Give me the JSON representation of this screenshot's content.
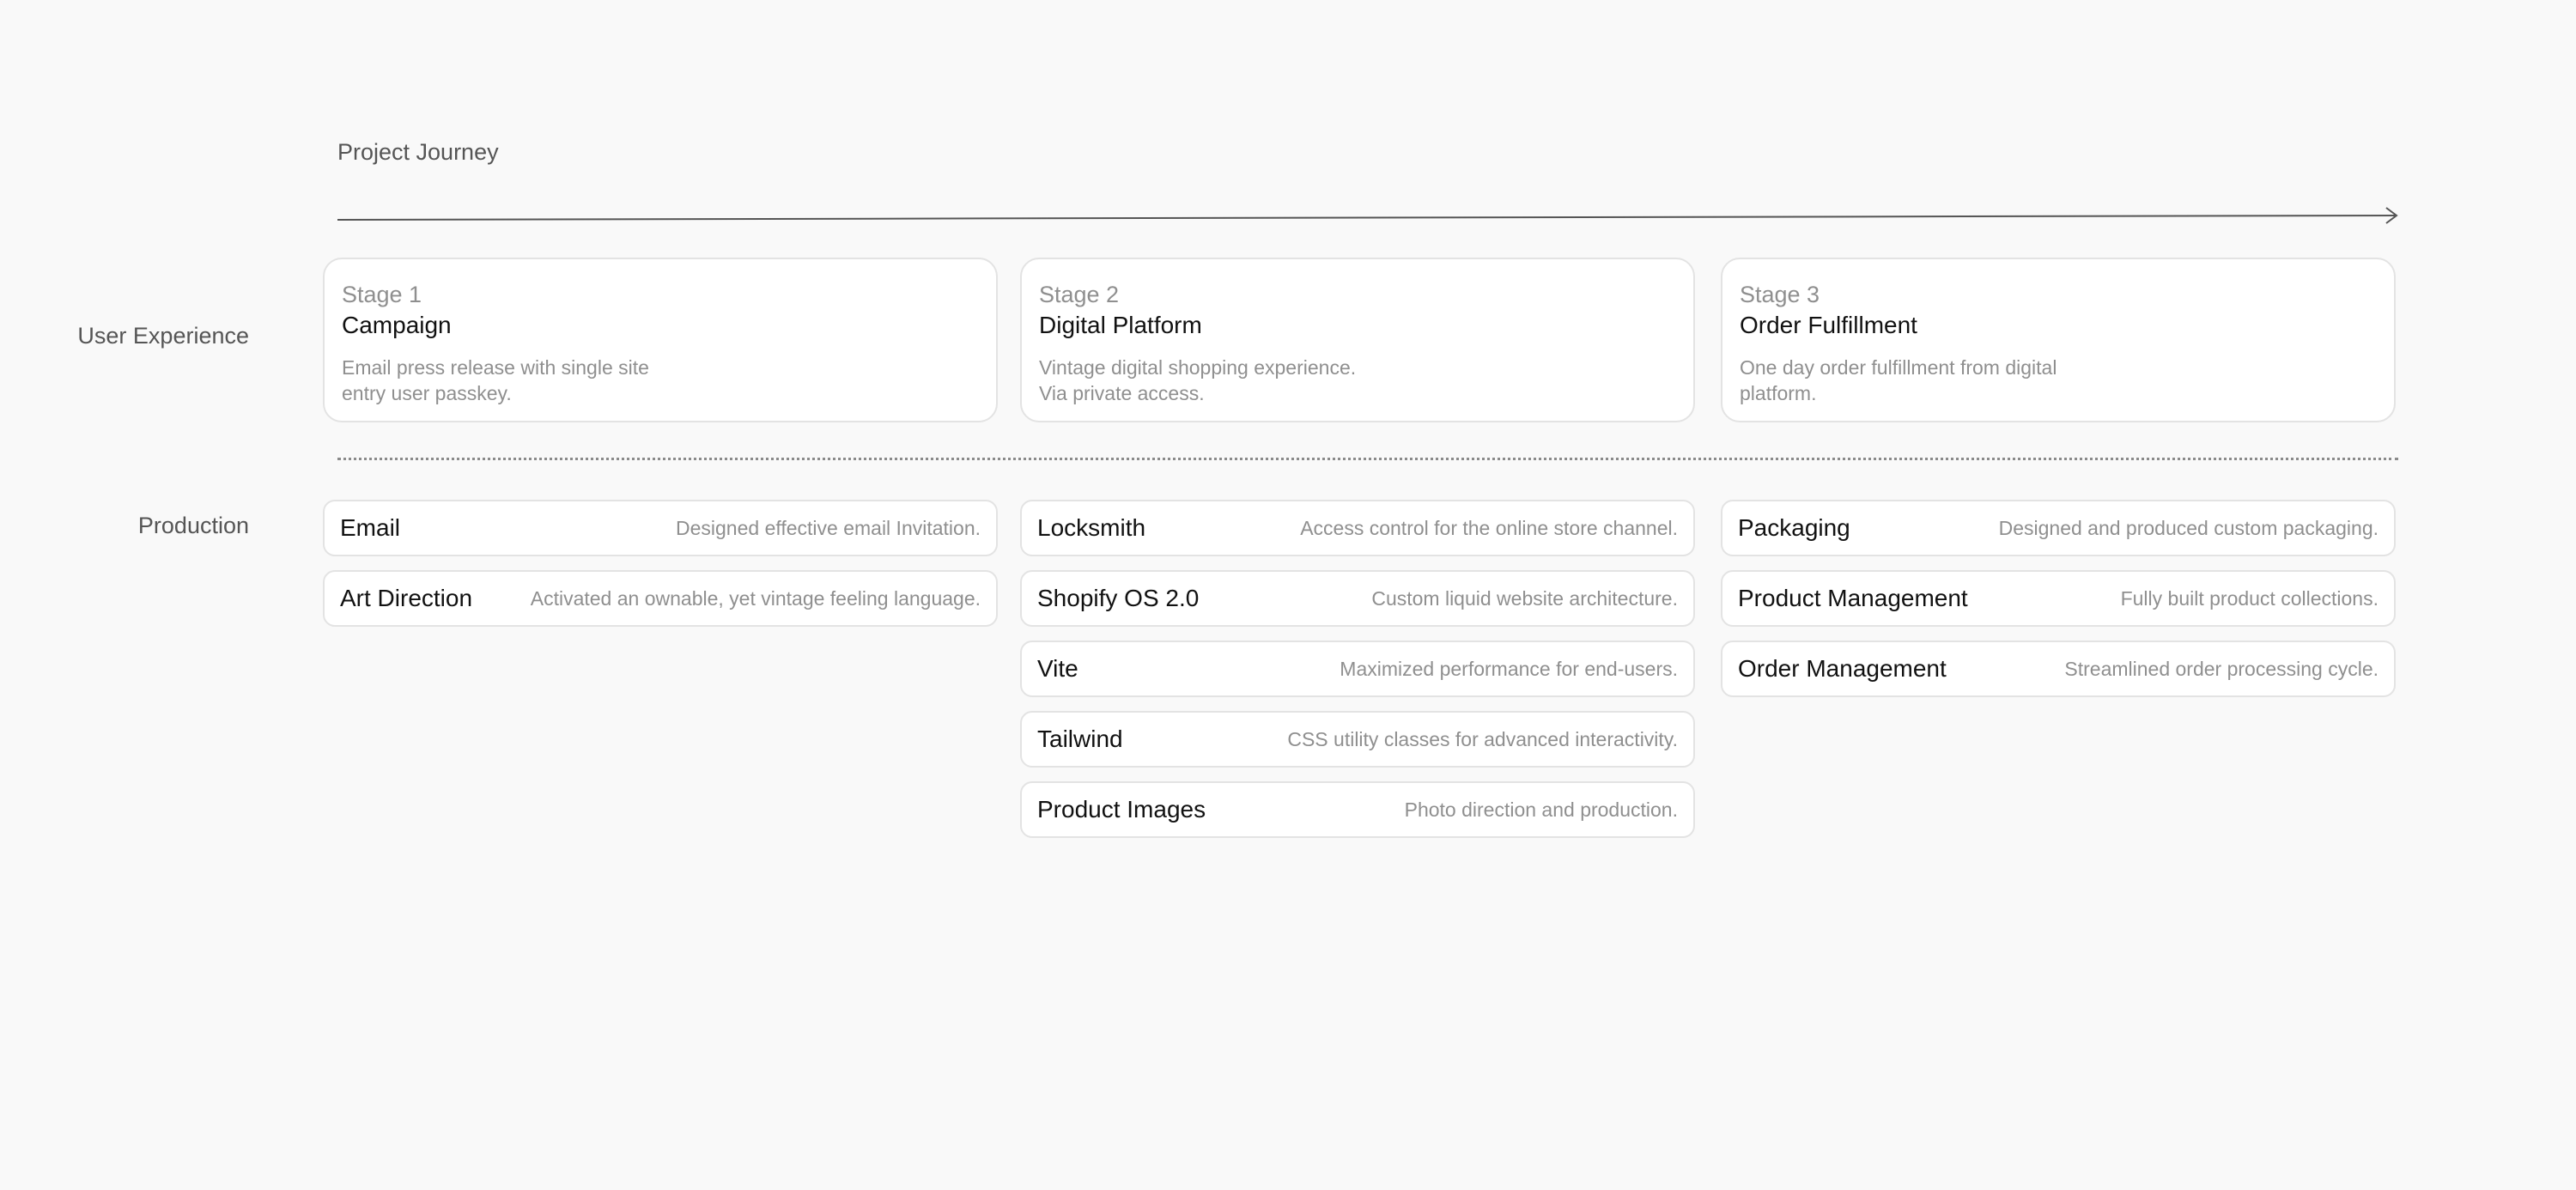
{
  "journey": {
    "title": "Project Journey"
  },
  "rows": {
    "ux_label": "User Experience",
    "production_label": "Production"
  },
  "stages": [
    {
      "number": "Stage 1",
      "name": "Campaign",
      "description": "Email press release with single site entry user passkey."
    },
    {
      "number": "Stage 2",
      "name": "Digital Platform",
      "description": "Vintage digital shopping experience. Via private access."
    },
    {
      "number": "Stage 3",
      "name": "Order Fulfillment",
      "description": "One day order fulfillment from digital platform."
    }
  ],
  "production": [
    [
      {
        "name": "Email",
        "description": "Designed effective email Invitation."
      },
      {
        "name": "Art Direction",
        "description": "Activated an ownable, yet vintage feeling language."
      }
    ],
    [
      {
        "name": "Locksmith",
        "description": "Access control for the online store channel."
      },
      {
        "name": "Shopify OS 2.0",
        "description": "Custom liquid website architecture."
      },
      {
        "name": "Vite",
        "description": "Maximized performance for end-users."
      },
      {
        "name": "Tailwind",
        "description": "CSS utility classes for advanced interactivity."
      },
      {
        "name": "Product Images",
        "description": "Photo direction and production."
      }
    ],
    [
      {
        "name": "Packaging",
        "description": "Designed and produced custom packaging."
      },
      {
        "name": "Product Management",
        "description": "Fully built product collections."
      },
      {
        "name": "Order Management",
        "description": "Streamlined order processing cycle."
      }
    ]
  ],
  "colors": {
    "background": "#f9f9f9",
    "card": "#ffffff",
    "border": "#e3e3e3",
    "muted_text": "#8f8f8f",
    "strong_text": "#111111"
  },
  "icons": {
    "journey_arrow": "arrow-right-icon"
  }
}
